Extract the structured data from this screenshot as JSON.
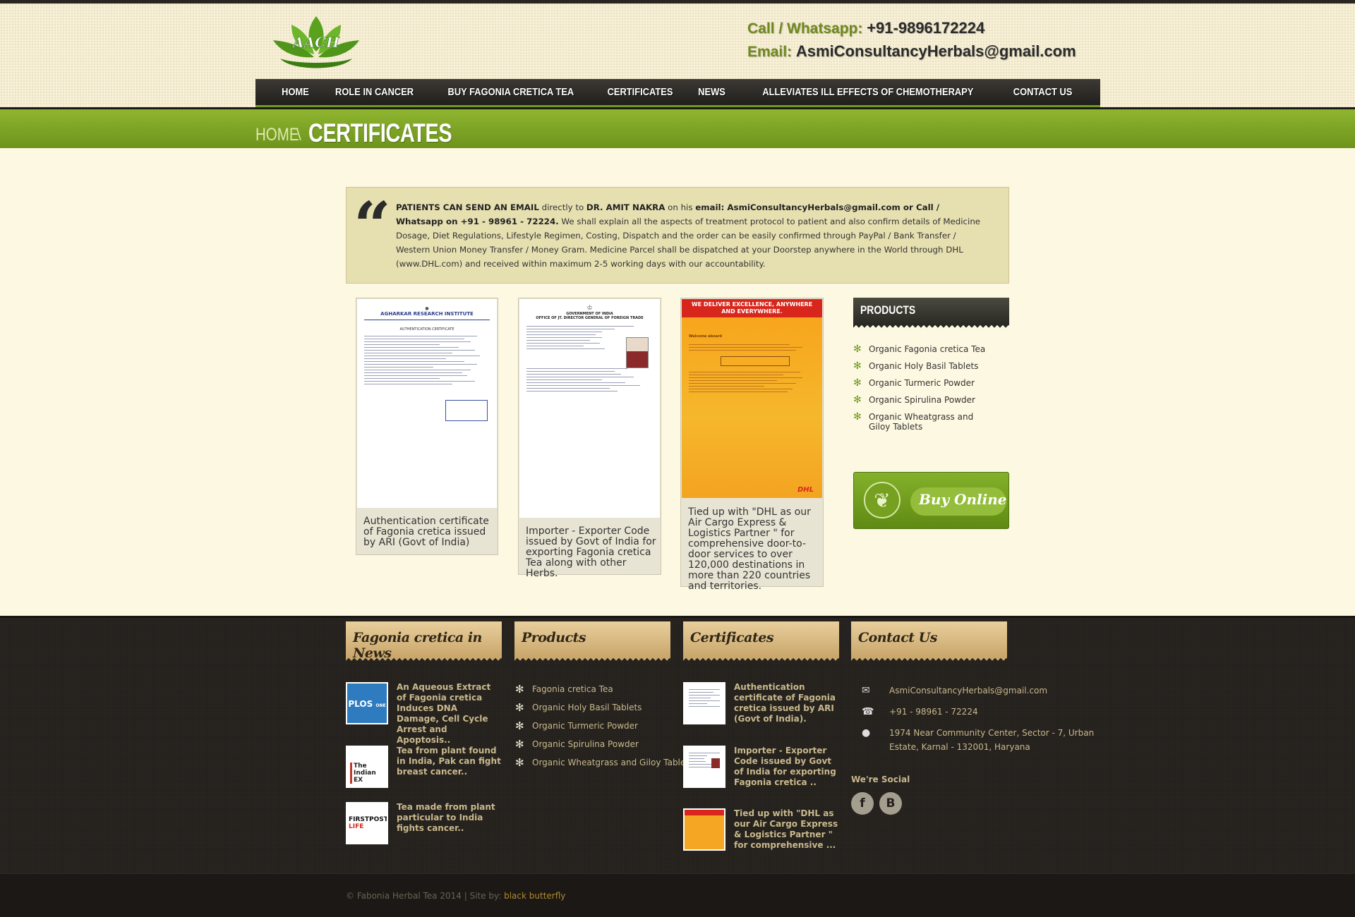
{
  "header": {
    "logo_text": "AACH",
    "call_label": "Call / Whatsapp:",
    "call_value": "+91-9896172224",
    "email_label": "Email:",
    "email_value": "AsmiConsultancyHerbals@gmail.com"
  },
  "nav": [
    "HOME",
    "ROLE IN CANCER",
    "BUY FAGONIA CRETICA TEA",
    "CERTIFICATES",
    "NEWS",
    "ALLEVIATES ILL EFFECTS OF CHEMOTHERAPY",
    "CONTACT US"
  ],
  "breadcrumb": {
    "home": "HOME",
    "separator": "\\",
    "current": "CERTIFICATES"
  },
  "notice": {
    "lead": "PATIENTS CAN SEND AN EMAIL",
    "t1": " directly to ",
    "doctor": "DR. AMIT NAKRA",
    "t2": " on his ",
    "email_part": "email: AsmiConsultancyHerbals@gmail.com or Call / Whatsapp on +91 - 98961 - 72224.",
    "rest": " We shall explain all the aspects of treatment protocol to patient and also confirm details of Medicine Dosage, Diet Regulations, Lifestyle Regimen, Costing, Dispatch and the order can be easily confirmed through PayPal / Bank Transfer / Western Union Money Transfer / Money Gram. Medicine Parcel shall be dispatched at your Doorstep anywhere in the World through DHL (www.DHL.com) and received within maximum 2-5 working days with our accountability."
  },
  "certificates": [
    {
      "doc_header": "AGHARKAR RESEARCH INSTITUTE",
      "doc_sub": "AUTHENTICATION CERTIFICATE",
      "caption": "Authentication certificate of Fagonia cretica issued by ARI (Govt of India)"
    },
    {
      "doc_header": "GOVERNMENT OF INDIA",
      "doc_sub": "OFFICE OF JT. DIRECTOR GENERAL OF FOREIGN TRADE",
      "caption": "Importer - Exporter Code issued by Govt of India for exporting Fagonia cretica Tea along with other Herbs."
    },
    {
      "doc_header": "WE DELIVER EXCELLENCE, ANYWHERE AND EVERYWHERE.",
      "doc_sub": "Welcome aboard",
      "doc_logo": "DHL",
      "caption": "Tied up with \"DHL as our Air Cargo Express & Logistics Partner \" for comprehensive door-to-door services to over 120,000 destinations in more than 220 countries and territories."
    }
  ],
  "products_widget": {
    "title": "PRODUCTS",
    "items": [
      "Organic Fagonia cretica Tea",
      "Organic Holy Basil Tablets",
      "Organic Turmeric Powder",
      "Organic Spirulina Powder",
      "Organic Wheatgrass and Giloy Tablets"
    ]
  },
  "buy_online": {
    "label": "Buy Online"
  },
  "footer": {
    "news": {
      "title": "Fagonia cretica in News",
      "items": [
        {
          "thumb": "PLOS",
          "thumb_sub": "ONE",
          "title": "An Aqueous Extract of Fagonia cretica Induces DNA Damage, Cell Cycle Arrest and Apoptosis.."
        },
        {
          "thumb": "The Indian EX",
          "title": "Tea from plant found in India, Pak can fight breast cancer.."
        },
        {
          "thumb": "FIRSTPOST",
          "thumb_sub": "LIFE",
          "title": "Tea made from plant particular to India fights cancer.."
        }
      ]
    },
    "products": {
      "title": "Products",
      "items": [
        "Fagonia cretica Tea",
        "Organic Holy Basil Tablets",
        "Organic Turmeric Powder",
        "Organic Spirulina Powder",
        "Organic Wheatgrass and Giloy Tablets"
      ]
    },
    "certificates": {
      "title": "Certificates",
      "items": [
        "Authentication certificate of Fagonia cretica issued by ARI (Govt of India).",
        "Importer - Exporter Code issued by Govt of India for exporting Fagonia cretica ..",
        "Tied up with \"DHL as our Air Cargo Express & Logistics Partner \" for comprehensive ..."
      ]
    },
    "contact": {
      "title": "Contact Us",
      "email": "AsmiConsultancyHerbals@gmail.com",
      "phone": "+91 - 98961 - 72224",
      "address": "1974 Near Community Center, Sector - 7, Urban Estate, Karnal - 132001, Haryana",
      "social_title": "We're Social",
      "social": [
        "f",
        "B"
      ]
    },
    "copyright": "© Fabonia Herbal Tea 2014 | Site by: ",
    "credit": "black butterfly"
  }
}
